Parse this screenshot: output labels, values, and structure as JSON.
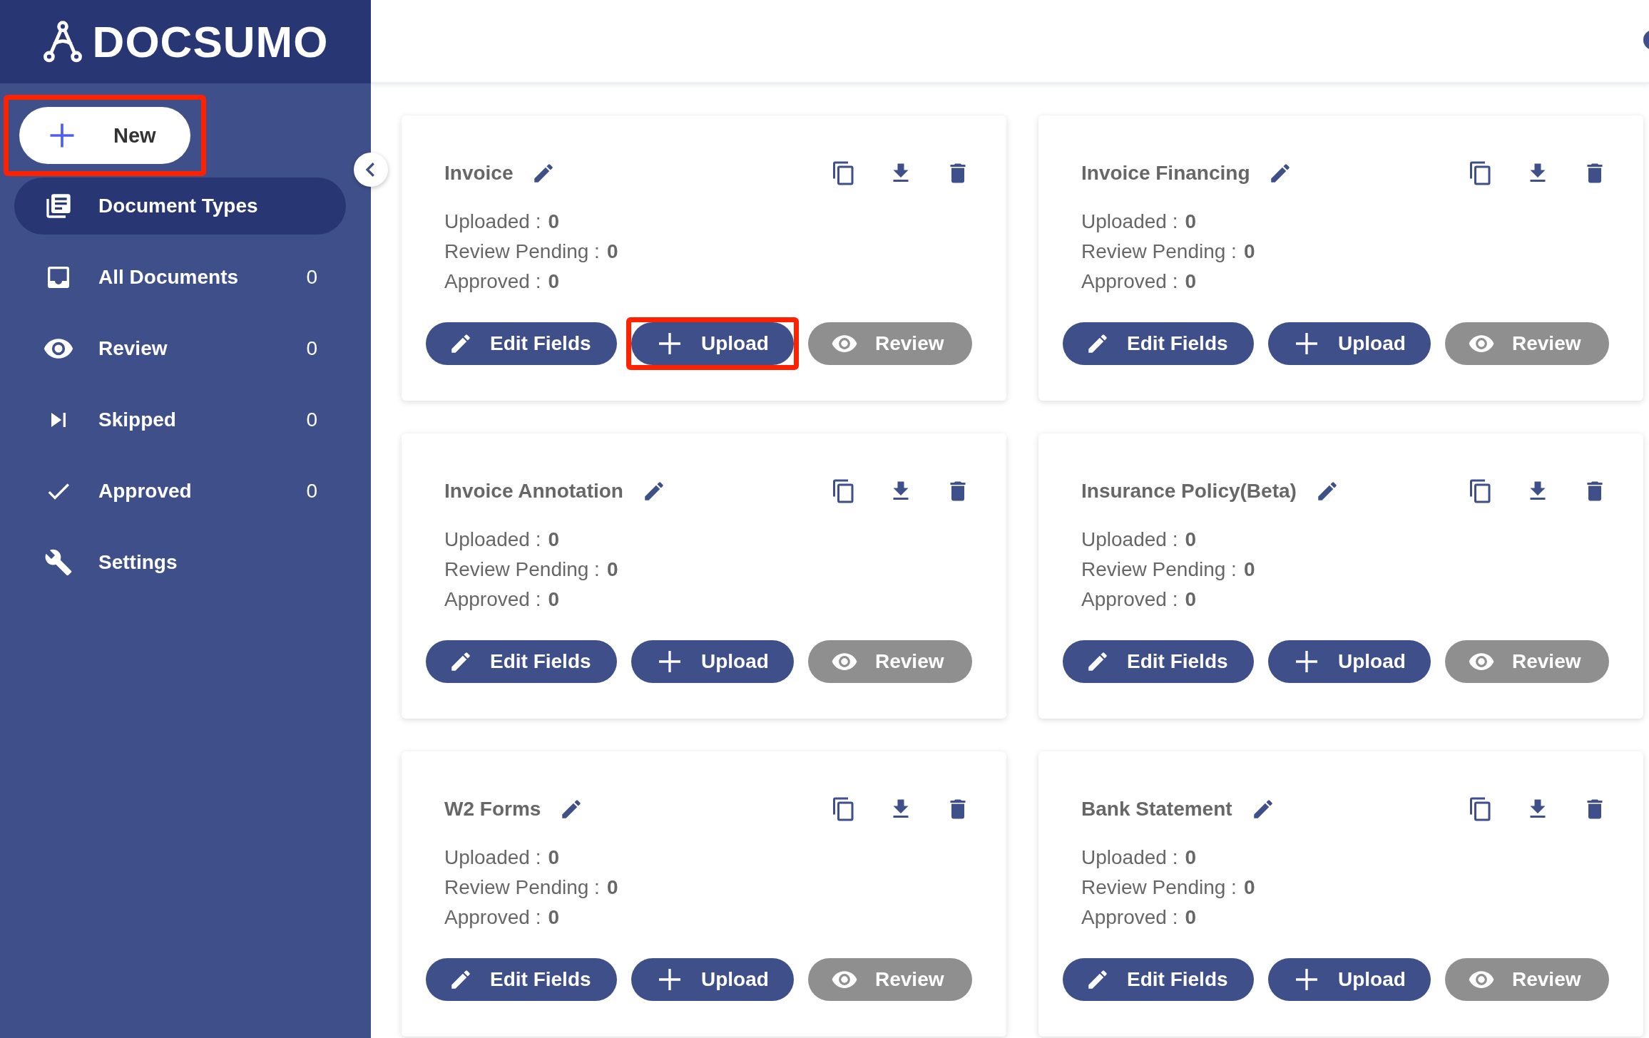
{
  "logo": {
    "text": "DOCSUMO"
  },
  "new_button": {
    "label": "New",
    "highlighted": true
  },
  "nav": [
    {
      "kind": "types",
      "label": "Document Types",
      "selected": true
    },
    {
      "kind": "all",
      "label": "All Documents",
      "count": "0",
      "selected": false
    },
    {
      "kind": "review",
      "label": "Review",
      "count": "0",
      "selected": false
    },
    {
      "kind": "skipped",
      "label": "Skipped",
      "count": "0",
      "selected": false
    },
    {
      "kind": "approved",
      "label": "Approved",
      "count": "0",
      "selected": false
    },
    {
      "kind": "settings",
      "label": "Settings",
      "selected": false
    }
  ],
  "cards": [
    {
      "title": "Invoice",
      "stats": [
        {
          "label": "Uploaded :",
          "value": "0"
        },
        {
          "label": "Review Pending :",
          "value": "0"
        },
        {
          "label": "Approved :",
          "value": "0"
        }
      ],
      "buttons": [
        {
          "kind": "edit",
          "label": "Edit Fields",
          "disabled": false,
          "highlighted": false
        },
        {
          "kind": "upload",
          "label": "Upload",
          "disabled": false,
          "highlighted": true
        },
        {
          "kind": "review",
          "label": "Review",
          "disabled": true,
          "highlighted": false
        }
      ]
    },
    {
      "title": "Invoice Financing",
      "stats": [
        {
          "label": "Uploaded :",
          "value": "0"
        },
        {
          "label": "Review Pending :",
          "value": "0"
        },
        {
          "label": "Approved :",
          "value": "0"
        }
      ],
      "buttons": [
        {
          "kind": "edit",
          "label": "Edit Fields",
          "disabled": false,
          "highlighted": false
        },
        {
          "kind": "upload",
          "label": "Upload",
          "disabled": false,
          "highlighted": false
        },
        {
          "kind": "review",
          "label": "Review",
          "disabled": true,
          "highlighted": false
        }
      ]
    },
    {
      "title": "Invoice Annotation",
      "stats": [
        {
          "label": "Uploaded :",
          "value": "0"
        },
        {
          "label": "Review Pending :",
          "value": "0"
        },
        {
          "label": "Approved :",
          "value": "0"
        }
      ],
      "buttons": [
        {
          "kind": "edit",
          "label": "Edit Fields",
          "disabled": false,
          "highlighted": false
        },
        {
          "kind": "upload",
          "label": "Upload",
          "disabled": false,
          "highlighted": false
        },
        {
          "kind": "review",
          "label": "Review",
          "disabled": true,
          "highlighted": false
        }
      ]
    },
    {
      "title": "Insurance Policy(Beta)",
      "stats": [
        {
          "label": "Uploaded :",
          "value": "0"
        },
        {
          "label": "Review Pending :",
          "value": "0"
        },
        {
          "label": "Approved :",
          "value": "0"
        }
      ],
      "buttons": [
        {
          "kind": "edit",
          "label": "Edit Fields",
          "disabled": false,
          "highlighted": false
        },
        {
          "kind": "upload",
          "label": "Upload",
          "disabled": false,
          "highlighted": false
        },
        {
          "kind": "review",
          "label": "Review",
          "disabled": true,
          "highlighted": false
        }
      ]
    },
    {
      "title": "W2 Forms",
      "stats": [
        {
          "label": "Uploaded :",
          "value": "0"
        },
        {
          "label": "Review Pending :",
          "value": "0"
        },
        {
          "label": "Approved :",
          "value": "0"
        }
      ],
      "buttons": [
        {
          "kind": "edit",
          "label": "Edit Fields",
          "disabled": false,
          "highlighted": false
        },
        {
          "kind": "upload",
          "label": "Upload",
          "disabled": false,
          "highlighted": false
        },
        {
          "kind": "review",
          "label": "Review",
          "disabled": true,
          "highlighted": false
        }
      ]
    },
    {
      "title": "Bank Statement",
      "stats": [
        {
          "label": "Uploaded :",
          "value": "0"
        },
        {
          "label": "Review Pending :",
          "value": "0"
        },
        {
          "label": "Approved :",
          "value": "0"
        }
      ],
      "buttons": [
        {
          "kind": "edit",
          "label": "Edit Fields",
          "disabled": false,
          "highlighted": false
        },
        {
          "kind": "upload",
          "label": "Upload",
          "disabled": false,
          "highlighted": false
        },
        {
          "kind": "review",
          "label": "Review",
          "disabled": true,
          "highlighted": false
        }
      ]
    }
  ]
}
